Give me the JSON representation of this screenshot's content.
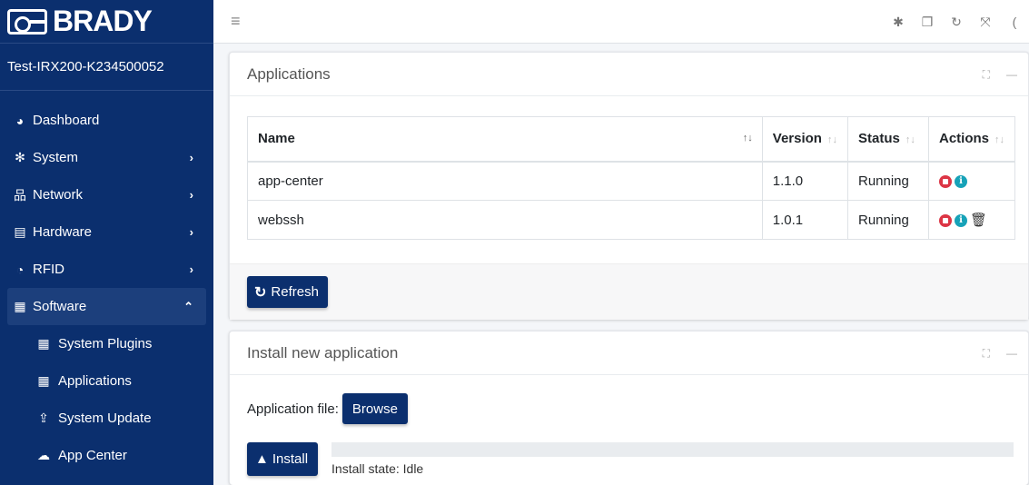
{
  "brand": {
    "name": "BRADY"
  },
  "device_name": "Test-IRX200-K234500052",
  "nav": {
    "dashboard": {
      "label": "Dashboard",
      "icon": "dashboard-icon"
    },
    "system": {
      "label": "System",
      "icon": "gear-icon"
    },
    "network": {
      "label": "Network",
      "icon": "network-icon"
    },
    "hardware": {
      "label": "Hardware",
      "icon": "chip-icon"
    },
    "rfid": {
      "label": "RFID",
      "icon": "rfid-icon"
    },
    "software": {
      "label": "Software",
      "icon": "grid-icon"
    },
    "software_sub": {
      "system_plugins": {
        "label": "System Plugins",
        "icon": "plugins-icon"
      },
      "applications": {
        "label": "Applications",
        "icon": "grid-icon"
      },
      "system_update": {
        "label": "System Update",
        "icon": "upload-icon"
      },
      "app_center": {
        "label": "App Center",
        "icon": "cloud-icon"
      }
    }
  },
  "applications_card": {
    "title": "Applications",
    "columns": {
      "name": "Name",
      "version": "Version",
      "status": "Status",
      "actions": "Actions"
    },
    "rows": [
      {
        "name": "app-center",
        "version": "1.1.0",
        "status": "Running"
      },
      {
        "name": "webssh",
        "version": "1.0.1",
        "status": "Running"
      }
    ],
    "refresh_label": "Refresh"
  },
  "install_card": {
    "title": "Install new application",
    "file_label": "Application file:",
    "browse_label": "Browse",
    "install_label": "Install",
    "progress": 0,
    "install_state": "Install state: Idle"
  },
  "colors": {
    "brand_navy": "#0b2f6e",
    "stop_red": "#dc3545",
    "info_teal": "#17a2b8"
  }
}
